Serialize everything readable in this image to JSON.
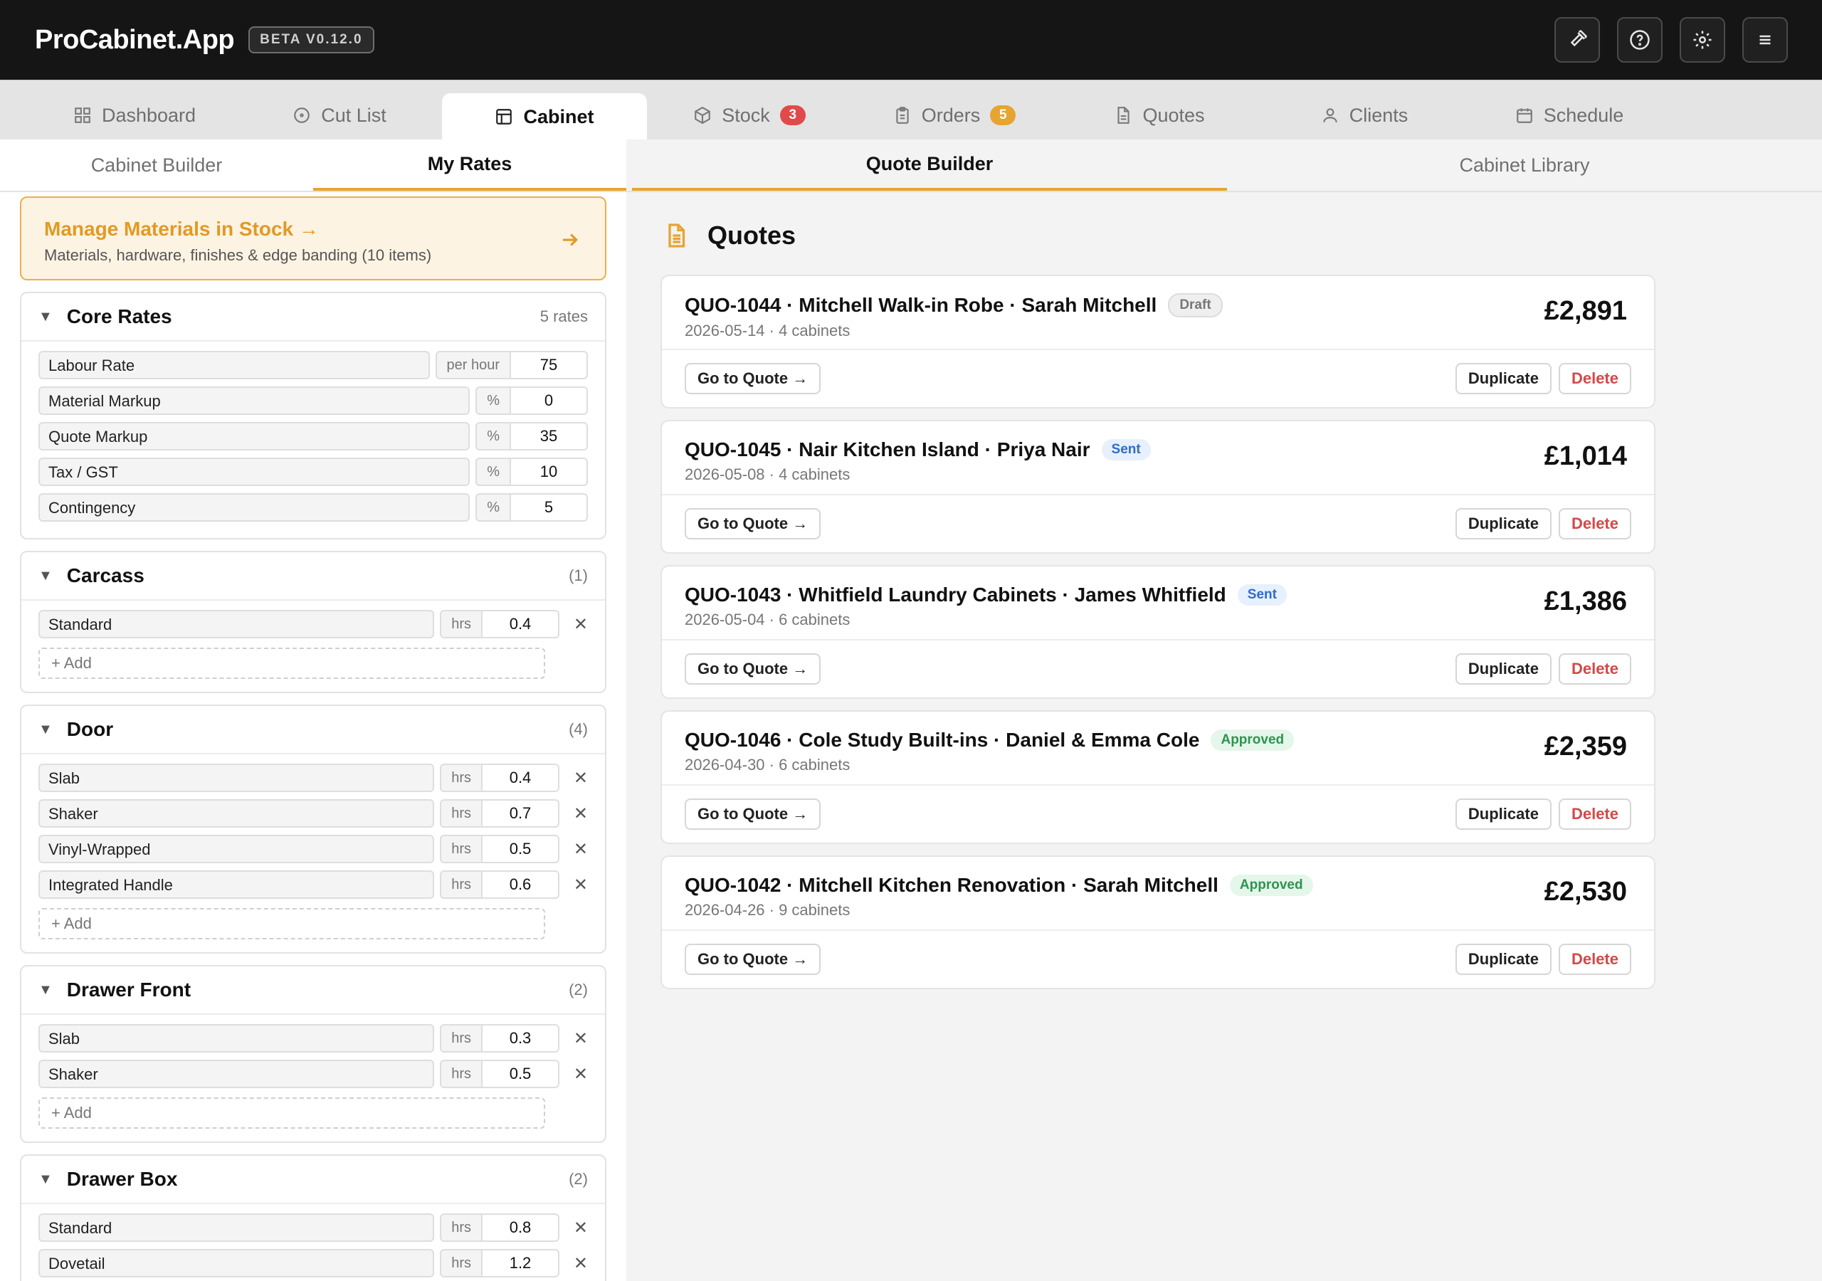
{
  "app": {
    "title": "ProCabinet.App",
    "version": "BETA V0.12.0"
  },
  "top_actions": [
    {
      "name": "hammer-icon",
      "label": "tools"
    },
    {
      "name": "help-icon",
      "label": "help"
    },
    {
      "name": "gear-icon",
      "label": "settings"
    },
    {
      "name": "menu-icon",
      "label": "menu"
    }
  ],
  "main_tabs": [
    {
      "label": "Dashboard",
      "icon": "grid-icon"
    },
    {
      "label": "Cut List",
      "icon": "target-icon"
    },
    {
      "label": "Cabinet",
      "icon": "layout-icon",
      "active": true
    },
    {
      "label": "Stock",
      "icon": "box-icon",
      "badge": "3",
      "badge_color": "#e04a4a"
    },
    {
      "label": "Orders",
      "icon": "clipboard-icon",
      "badge": "5",
      "badge_color": "#e6a431"
    },
    {
      "label": "Quotes",
      "icon": "document-icon"
    },
    {
      "label": "Clients",
      "icon": "user-icon"
    },
    {
      "label": "Schedule",
      "icon": "calendar-icon"
    }
  ],
  "left": {
    "subtabs": [
      "Cabinet Builder",
      "My Rates"
    ],
    "manage": {
      "title": "Manage Materials in Stock →",
      "subtitle": "Materials, hardware, finishes & edge banding (10 items)"
    },
    "core": {
      "title": "Core Rates",
      "count": "5 rates",
      "rows": [
        {
          "name": "Labour Rate",
          "unit": "per hour",
          "value": "75"
        },
        {
          "name": "Material Markup",
          "unit": "%",
          "value": "0"
        },
        {
          "name": "Quote Markup",
          "unit": "%",
          "value": "35"
        },
        {
          "name": "Tax / GST",
          "unit": "%",
          "value": "10"
        },
        {
          "name": "Contingency",
          "unit": "%",
          "value": "5"
        }
      ]
    },
    "carcass": {
      "title": "Carcass",
      "count": "(1)",
      "add": "+ Add",
      "rows": [
        {
          "name": "Standard",
          "unit": "hrs",
          "value": "0.4"
        }
      ]
    },
    "door": {
      "title": "Door",
      "count": "(4)",
      "add": "+ Add",
      "rows": [
        {
          "name": "Slab",
          "unit": "hrs",
          "value": "0.4"
        },
        {
          "name": "Shaker",
          "unit": "hrs",
          "value": "0.7"
        },
        {
          "name": "Vinyl-Wrapped",
          "unit": "hrs",
          "value": "0.5"
        },
        {
          "name": "Integrated Handle",
          "unit": "hrs",
          "value": "0.6"
        }
      ]
    },
    "drawer_front": {
      "title": "Drawer Front",
      "count": "(2)",
      "add": "+ Add",
      "rows": [
        {
          "name": "Slab",
          "unit": "hrs",
          "value": "0.3"
        },
        {
          "name": "Shaker",
          "unit": "hrs",
          "value": "0.5"
        }
      ]
    },
    "drawer_box": {
      "title": "Drawer Box",
      "count": "(2)",
      "rows": [
        {
          "name": "Standard",
          "unit": "hrs",
          "value": "0.8"
        },
        {
          "name": "Dovetail",
          "unit": "hrs",
          "value": "1.2"
        }
      ]
    },
    "remove_symbol": "✕"
  },
  "right": {
    "tabs": [
      "Quote Builder",
      "Cabinet Library"
    ],
    "heading": "Quotes",
    "buttons": {
      "go": "Go to Quote →",
      "duplicate": "Duplicate",
      "delete": "Delete"
    },
    "quotes": [
      {
        "title": "QUO-1044 · Mitchell Walk-in Robe · Sarah Mitchell",
        "status": "Draft",
        "status_kind": "draft",
        "meta": "2026-05-14 · 4 cabinets",
        "price": "£2,891"
      },
      {
        "title": "QUO-1045 · Nair Kitchen Island · Priya Nair",
        "status": "Sent",
        "status_kind": "sent",
        "meta": "2026-05-08 · 4 cabinets",
        "price": "£1,014"
      },
      {
        "title": "QUO-1043 · Whitfield Laundry Cabinets · James Whitfield",
        "status": "Sent",
        "status_kind": "sent",
        "meta": "2026-05-04 · 6 cabinets",
        "price": "£1,386"
      },
      {
        "title": "QUO-1046 · Cole Study Built-ins · Daniel & Emma Cole",
        "status": "Approved",
        "status_kind": "approved",
        "meta": "2026-04-30 · 6 cabinets",
        "price": "£2,359"
      },
      {
        "title": "QUO-1042 · Mitchell Kitchen Renovation · Sarah Mitchell",
        "status": "Approved",
        "status_kind": "approved",
        "meta": "2026-04-26 · 9 cabinets",
        "price": "£2,530"
      }
    ]
  }
}
